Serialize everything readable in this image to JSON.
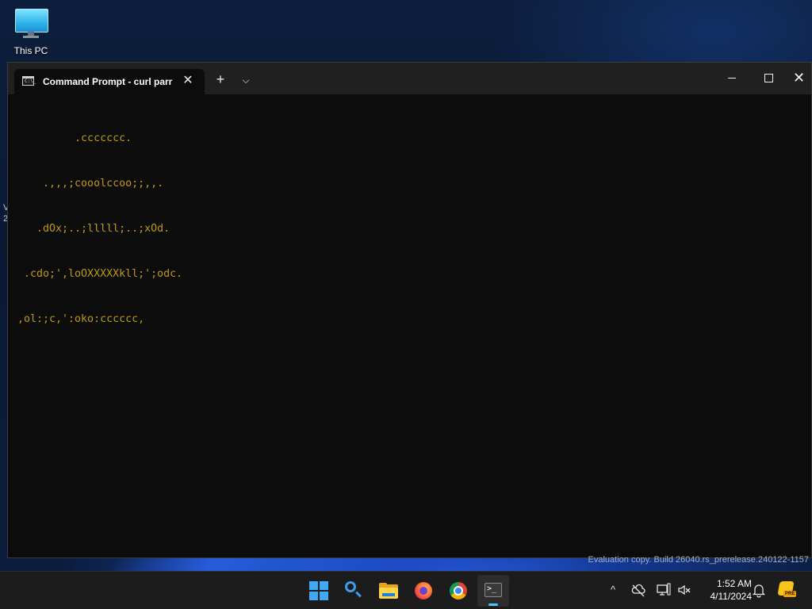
{
  "desktop": {
    "icon_label": "This PC",
    "partial_text_1": "V",
    "partial_text_2": "2"
  },
  "terminal": {
    "tab_title": "Command Prompt - curl  parr",
    "tab_close_glyph": "✕",
    "new_tab_glyph": "+",
    "dropdown_glyph": "⌵",
    "close_glyph": "✕",
    "icon_glyph": "C:\\_",
    "lines": [
      "         .ccccccc.",
      "    .,,,;cooolccoo;;,,.",
      "   .dOx;..;lllll;..;xOd.",
      " .cdo;',loOXXXXXkll;';odc.",
      ",ol:;c,':oko:cccccc,"
    ],
    "text_color": "#c19c00",
    "background_color": "#0c0c0c"
  },
  "watermark": "Evaluation copy. Build 26040.rs_prerelease.240122-1157",
  "taskbar": {
    "apps": [
      {
        "name": "start-button",
        "icon": "windows-logo-icon"
      },
      {
        "name": "search-button",
        "icon": "search-icon"
      },
      {
        "name": "file-explorer",
        "icon": "folder-icon"
      },
      {
        "name": "firefox",
        "icon": "firefox-icon"
      },
      {
        "name": "chrome",
        "icon": "chrome-icon"
      },
      {
        "name": "terminal",
        "icon": "terminal-icon",
        "active": true
      }
    ],
    "terminal_glyph": ">_"
  },
  "tray": {
    "chevron_glyph": "^",
    "network_glyph": "⌘",
    "volume_glyph": "🔇",
    "bell_glyph": "🔔",
    "time": "1:52 AM",
    "date": "4/11/2024",
    "pre_label": "PRE"
  },
  "colors": {
    "accent": "#4cc2ff",
    "taskbar": "#1c1c1c",
    "titlebar": "#202020"
  }
}
